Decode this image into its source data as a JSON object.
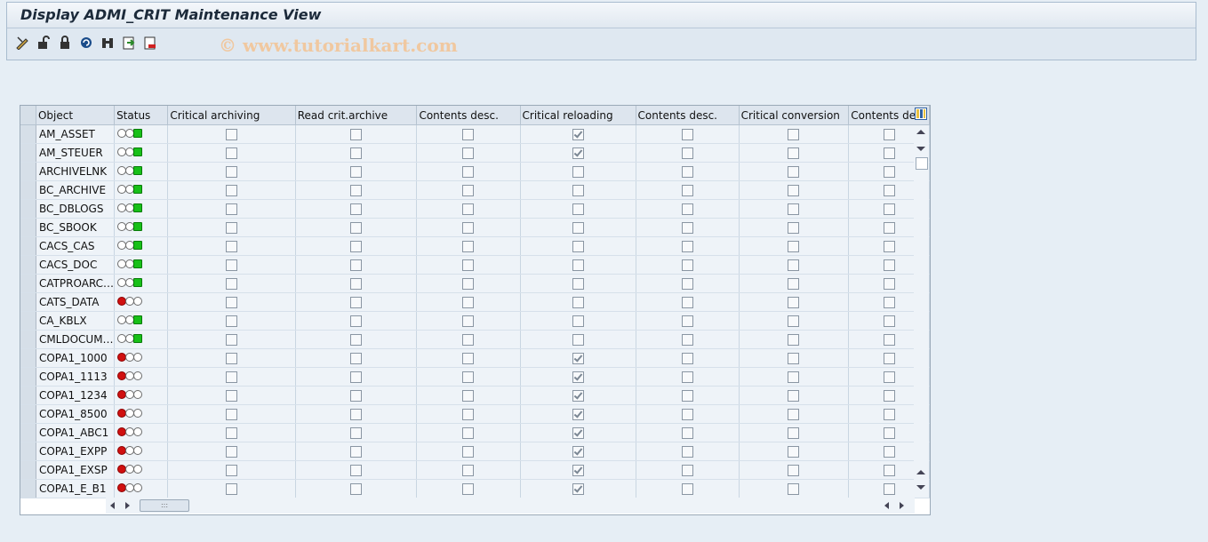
{
  "title": "Display ADMI_CRIT Maintenance View",
  "watermark": "© www.tutorialkart.com",
  "toolbar": [
    {
      "name": "display-change-icon"
    },
    {
      "name": "unlock-icon"
    },
    {
      "name": "lock-icon"
    },
    {
      "name": "refresh-icon"
    },
    {
      "name": "find-icon"
    },
    {
      "name": "export-icon"
    },
    {
      "name": "exit-icon"
    }
  ],
  "columns": [
    "Object",
    "Status",
    "Critical archiving",
    "Read crit.archive",
    "Contents desc.",
    "Critical reloading",
    "Contents desc.",
    "Critical conversion",
    "Contents desc"
  ],
  "status_legend": {
    "red": "#d01010",
    "green": "#18c018"
  },
  "rows": [
    {
      "object": "AM_ASSET",
      "status": "green",
      "checks": [
        false,
        false,
        false,
        true,
        false,
        false,
        false
      ]
    },
    {
      "object": "AM_STEUER",
      "status": "green",
      "checks": [
        false,
        false,
        false,
        true,
        false,
        false,
        false
      ]
    },
    {
      "object": "ARCHIVELNK",
      "status": "green",
      "checks": [
        false,
        false,
        false,
        false,
        false,
        false,
        false
      ]
    },
    {
      "object": "BC_ARCHIVE",
      "status": "green",
      "checks": [
        false,
        false,
        false,
        false,
        false,
        false,
        false
      ]
    },
    {
      "object": "BC_DBLOGS",
      "status": "green",
      "checks": [
        false,
        false,
        false,
        false,
        false,
        false,
        false
      ]
    },
    {
      "object": "BC_SBOOK",
      "status": "green",
      "checks": [
        false,
        false,
        false,
        false,
        false,
        false,
        false
      ]
    },
    {
      "object": "CACS_CAS",
      "status": "green",
      "checks": [
        false,
        false,
        false,
        false,
        false,
        false,
        false
      ]
    },
    {
      "object": "CACS_DOC",
      "status": "green",
      "checks": [
        false,
        false,
        false,
        false,
        false,
        false,
        false
      ]
    },
    {
      "object": "CATPROARC…",
      "status": "green",
      "checks": [
        false,
        false,
        false,
        false,
        false,
        false,
        false
      ]
    },
    {
      "object": "CATS_DATA",
      "status": "red",
      "checks": [
        false,
        false,
        false,
        false,
        false,
        false,
        false
      ]
    },
    {
      "object": "CA_KBLX",
      "status": "green",
      "checks": [
        false,
        false,
        false,
        false,
        false,
        false,
        false
      ]
    },
    {
      "object": "CMLDOCUM…",
      "status": "green",
      "checks": [
        false,
        false,
        false,
        false,
        false,
        false,
        false
      ]
    },
    {
      "object": "COPA1_1000",
      "status": "red",
      "checks": [
        false,
        false,
        false,
        true,
        false,
        false,
        false
      ]
    },
    {
      "object": "COPA1_1113",
      "status": "red",
      "checks": [
        false,
        false,
        false,
        true,
        false,
        false,
        false
      ]
    },
    {
      "object": "COPA1_1234",
      "status": "red",
      "checks": [
        false,
        false,
        false,
        true,
        false,
        false,
        false
      ]
    },
    {
      "object": "COPA1_8500",
      "status": "red",
      "checks": [
        false,
        false,
        false,
        true,
        false,
        false,
        false
      ]
    },
    {
      "object": "COPA1_ABC1",
      "status": "red",
      "checks": [
        false,
        false,
        false,
        true,
        false,
        false,
        false
      ]
    },
    {
      "object": "COPA1_EXPP",
      "status": "red",
      "checks": [
        false,
        false,
        false,
        true,
        false,
        false,
        false
      ]
    },
    {
      "object": "COPA1_EXSP",
      "status": "red",
      "checks": [
        false,
        false,
        false,
        true,
        false,
        false,
        false
      ]
    },
    {
      "object": "COPA1_E_B1",
      "status": "red",
      "checks": [
        false,
        false,
        false,
        true,
        false,
        false,
        false
      ]
    }
  ]
}
